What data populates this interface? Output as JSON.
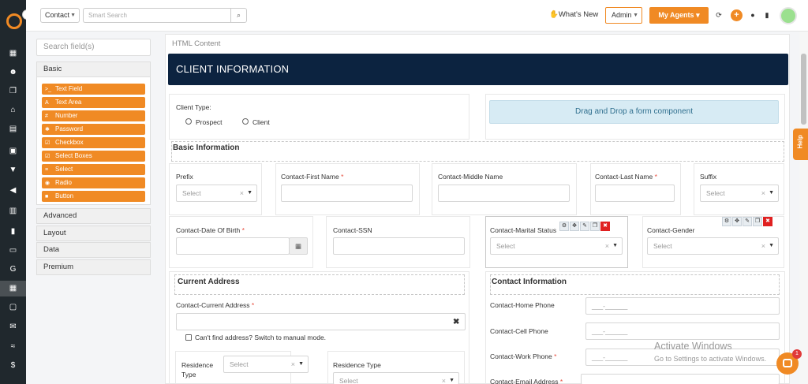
{
  "topbar": {
    "context_select": "Contact",
    "search_placeholder": "Smart Search",
    "whats_new": "What's New",
    "admin": "Admin",
    "my_agents": "My Agents"
  },
  "left_panel": {
    "search_placeholder": "Search field(s)",
    "basic": "Basic",
    "components": [
      {
        "icon": ">_",
        "label": "Text Field"
      },
      {
        "icon": "A",
        "label": "Text Area"
      },
      {
        "icon": "#",
        "label": "Number"
      },
      {
        "icon": "✱",
        "label": "Password"
      },
      {
        "icon": "☑",
        "label": "Checkbox"
      },
      {
        "icon": "☑",
        "label": "Select Boxes"
      },
      {
        "icon": "≡",
        "label": "Select"
      },
      {
        "icon": "◉",
        "label": "Radio"
      },
      {
        "icon": "■",
        "label": "Button"
      }
    ],
    "sections": [
      "Advanced",
      "Layout",
      "Data",
      "Premium"
    ]
  },
  "form": {
    "html_content": "HTML Content",
    "header": "CLIENT INFORMATION",
    "client_type": "Client Type:",
    "prospect": "Prospect",
    "client": "Client",
    "drag_drop": "Drag and Drop a form component",
    "basic_info": "Basic Information",
    "prefix": "Prefix",
    "first_name": "Contact-First Name",
    "middle_name": "Contact-Middle Name",
    "last_name": "Contact-Last Name",
    "suffix": "Suffix",
    "dob": "Contact-Date Of Birth",
    "ssn": "Contact-SSN",
    "marital": "Contact-Marital Status",
    "gender": "Contact-Gender",
    "select": "Select",
    "req": "*",
    "current_address": "Current Address",
    "current_address_field": "Contact-Current Address",
    "cant_find": "Can't find address? Switch to manual mode.",
    "residence_type": "Residence Type",
    "residence": "Residence",
    "type": "Type",
    "contact_information": "Contact Information",
    "home_phone": "Contact-Home Phone",
    "cell_phone": "Contact-Cell Phone",
    "work_phone": "Contact-Work Phone",
    "email": "Contact-Email Address",
    "phone_mask": "___-______"
  },
  "help": "Help",
  "watermark": {
    "title": "Activate Windows",
    "subtitle": "Go to Settings to activate Windows."
  },
  "chat_badge": "1",
  "colors": {
    "accent": "#f08a24",
    "header_navy": "#0c2340",
    "rail": "#20282d",
    "required": "#e74c3c"
  }
}
